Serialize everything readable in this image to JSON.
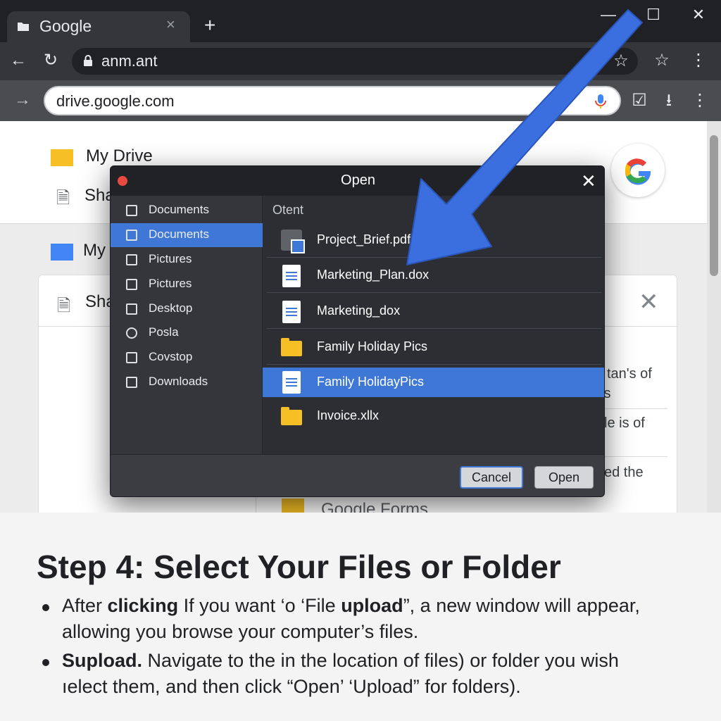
{
  "browser": {
    "tab_title": "Google",
    "tab_close": "×",
    "new_tab": "+",
    "window_controls": {
      "minimize": "—",
      "maximize": "☐",
      "close": "✕"
    },
    "address_bar_1": "anm.ant",
    "address_bar_2": "drive.google.com",
    "icons": [
      "back-arrow-icon",
      "reload-icon",
      "lock-icon",
      "star-icon",
      "bookmark-icon",
      "menu-dots-icon",
      "forward-icon",
      "mic-icon",
      "checkbox-icon",
      "download-icon"
    ]
  },
  "drive": {
    "my_drive_label": "My Drive",
    "shared_label_1": "Sha",
    "my_label_2": "My",
    "shared_label_2": "Sha",
    "bg_lines": [
      "tan's of",
      "ts",
      "le is of",
      "ed the"
    ],
    "bottom_item": "Google Forms"
  },
  "dialog": {
    "title": "Open",
    "close": "✕",
    "sidebar": [
      {
        "label": "Documents",
        "icon": "document-icon",
        "selected": false
      },
      {
        "label": "Documents",
        "icon": "document-icon",
        "selected": true
      },
      {
        "label": "Pictures",
        "icon": "picture-icon",
        "selected": false
      },
      {
        "label": "Pictures",
        "icon": "picture-icon",
        "selected": false
      },
      {
        "label": "Desktop",
        "icon": "desktop-icon",
        "selected": false
      },
      {
        "label": "Posla",
        "icon": "network-icon",
        "selected": false
      },
      {
        "label": "Covstop",
        "icon": "edit-icon",
        "selected": false
      },
      {
        "label": "Downloads",
        "icon": "download-icon",
        "selected": false
      }
    ],
    "header": "Otent",
    "files": [
      {
        "name": "Project_Brief.pdf",
        "icon": "pdf-icon",
        "selected": false
      },
      {
        "name": "Marketing_Plan.dox",
        "icon": "doc-icon",
        "selected": false
      },
      {
        "name": "Marketing_dox",
        "icon": "doc-icon",
        "selected": false
      },
      {
        "name": "Family Holiday Pics",
        "icon": "folder-icon",
        "selected": false
      },
      {
        "name": "Family HolidayPics",
        "icon": "doc-icon",
        "selected": true
      },
      {
        "name": "Invoice.xllx",
        "icon": "folder-icon",
        "selected": false
      }
    ],
    "cancel_label": "Cancel",
    "open_label": "Open"
  },
  "caption": {
    "title": "Step 4: Select Your Files or Folder",
    "bullet1_line1_parts": [
      "After ",
      "clicking",
      " If you want ‘o ‘File ",
      "upload",
      "”, a new window will appear,"
    ],
    "bullet1_line2": "allowing you browse your computer’s files.",
    "bullet2_line1_parts": [
      "Supload.",
      " Navigate to the in the location of files) or folder you wish"
    ],
    "bullet2_line2": "ıelect them, and then click “Open’ ‘Upload” for folders)."
  },
  "colors": {
    "accent_blue": "#3e77d6",
    "arrow_blue": "#3b6fe0",
    "folder_yellow": "#f6bf26",
    "chrome_dark": "#202124",
    "dialog_bg": "#2e3035"
  }
}
